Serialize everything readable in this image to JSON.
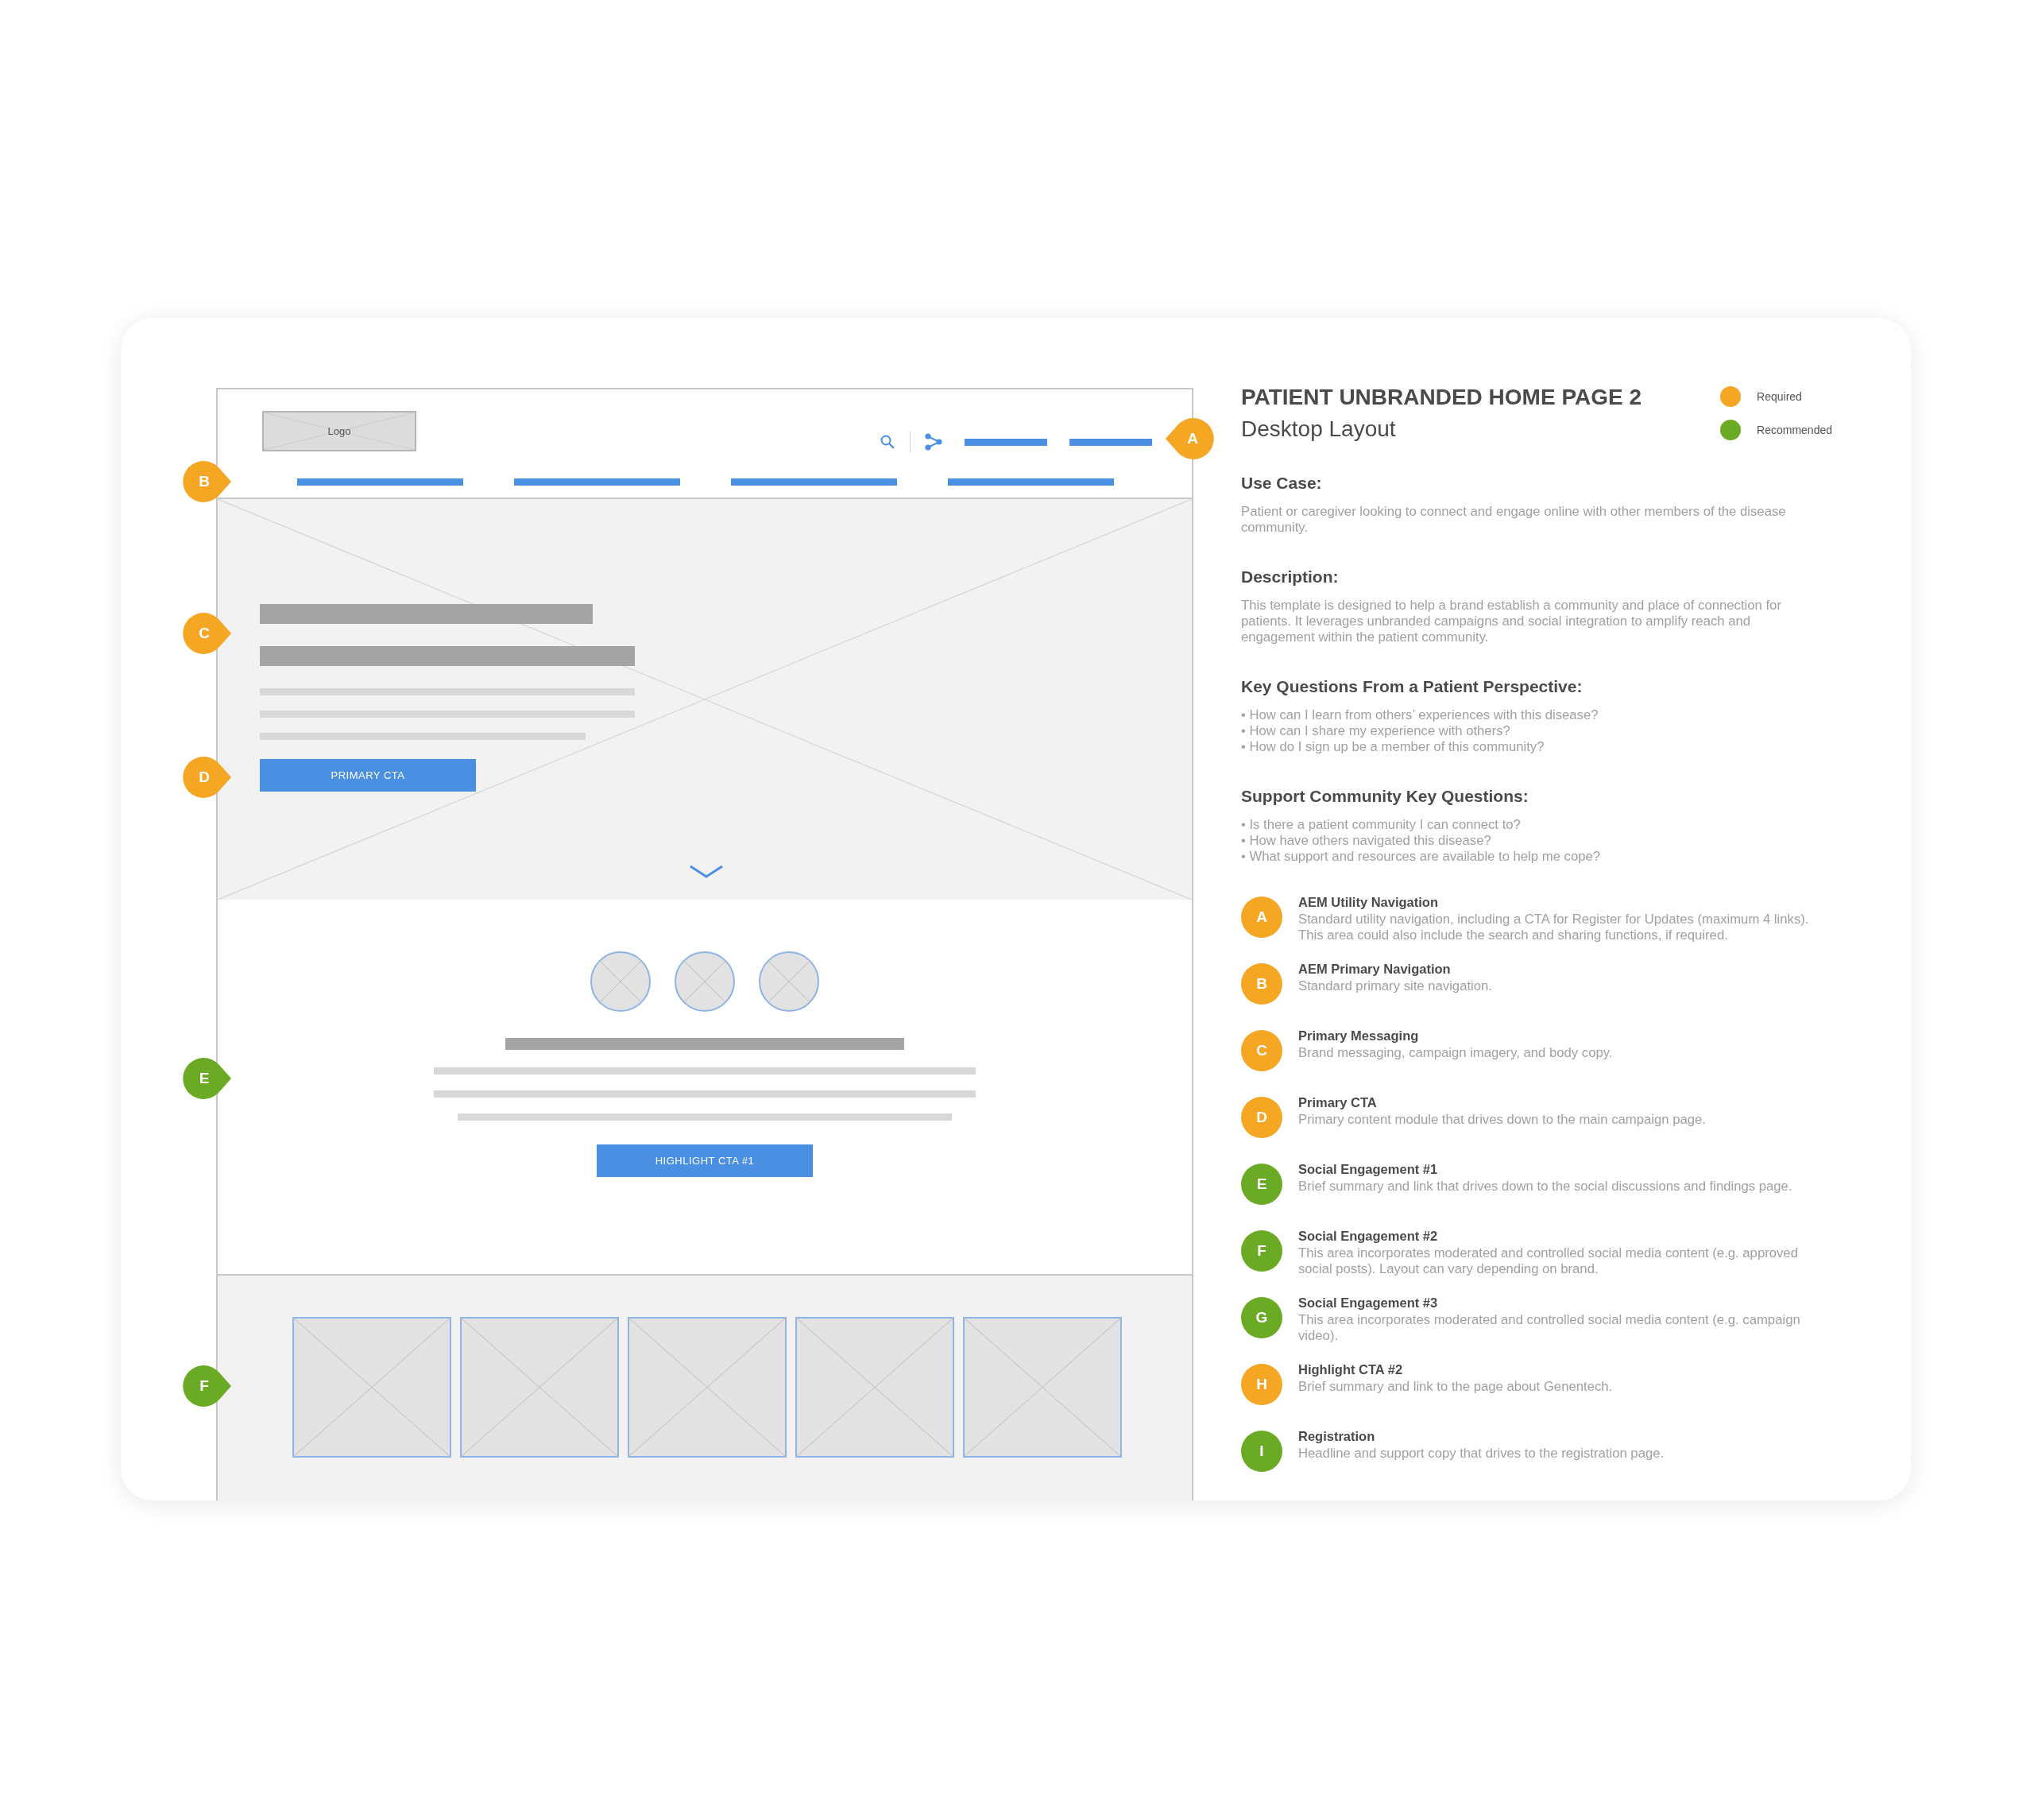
{
  "wireframe": {
    "logo": "Logo",
    "primary_cta": "PRIMARY CTA",
    "highlight_cta": "HIGHLIGHT CTA #1",
    "markers": [
      {
        "letter": "A",
        "color": "#f5a623"
      },
      {
        "letter": "B",
        "color": "#f5a623"
      },
      {
        "letter": "C",
        "color": "#f5a623"
      },
      {
        "letter": "D",
        "color": "#f5a623"
      },
      {
        "letter": "E",
        "color": "#6aaa24"
      },
      {
        "letter": "F",
        "color": "#6aaa24"
      }
    ]
  },
  "title": "PATIENT UNBRANDED HOME PAGE 2",
  "subtitle": "Desktop Layout",
  "legend": [
    {
      "label": "Required",
      "color": "#f5a623"
    },
    {
      "label": "Recommended",
      "color": "#6aaa24"
    }
  ],
  "sections": [
    {
      "heading": "Use Case:",
      "kind": "text",
      "text": "Patient or caregiver looking to connect and engage online with other members of the disease community."
    },
    {
      "heading": "Description:",
      "kind": "text",
      "text": "This template is designed to help a brand establish a community and place of connection for patients.  It leverages unbranded campaigns and social integration to amplify reach and engagement within the patient community."
    },
    {
      "heading": "Key Questions From a Patient Perspective:",
      "kind": "bullets",
      "items": [
        "• How can I learn from others’ experiences with this disease?",
        "• How can I share my experience with others?",
        "• How do I sign up be a member of this community?"
      ]
    },
    {
      "heading": "Support Community Key Questions:",
      "kind": "bullets",
      "items": [
        "• Is there a patient community I can connect to?",
        "• How have others navigated this disease?",
        "• What support and resources are available to help me cope?"
      ]
    }
  ],
  "components": [
    {
      "letter": "A",
      "color": "#f5a623",
      "title": "AEM Utility Navigation",
      "description": "Standard utility navigation, including a CTA for Register for Updates (maximum 4 links). This area could also include the search and sharing functions, if required."
    },
    {
      "letter": "B",
      "color": "#f5a623",
      "title": "AEM Primary Navigation",
      "description": "Standard primary site navigation."
    },
    {
      "letter": "C",
      "color": "#f5a623",
      "title": "Primary Messaging",
      "description": "Brand messaging, campaign imagery, and body copy."
    },
    {
      "letter": "D",
      "color": "#f5a623",
      "title": "Primary CTA",
      "description": "Primary content module that drives down to the main campaign page."
    },
    {
      "letter": "E",
      "color": "#6aaa24",
      "title": "Social Engagement #1",
      "description": "Brief summary and link that drives down to the social discussions and findings page."
    },
    {
      "letter": "F",
      "color": "#6aaa24",
      "title": "Social Engagement #2",
      "description": "This area incorporates moderated and controlled social media content (e.g. approved social posts). Layout can vary depending on brand."
    },
    {
      "letter": "G",
      "color": "#6aaa24",
      "title": "Social Engagement #3",
      "description": "This area incorporates moderated and controlled social media content (e.g. campaign video)."
    },
    {
      "letter": "H",
      "color": "#f5a623",
      "title": "Highlight CTA #2",
      "description": "Brief summary and link to the page about Genentech."
    },
    {
      "letter": "I",
      "color": "#6aaa24",
      "title": "Registration",
      "description": "Headline and support copy that drives to the registration page."
    }
  ]
}
